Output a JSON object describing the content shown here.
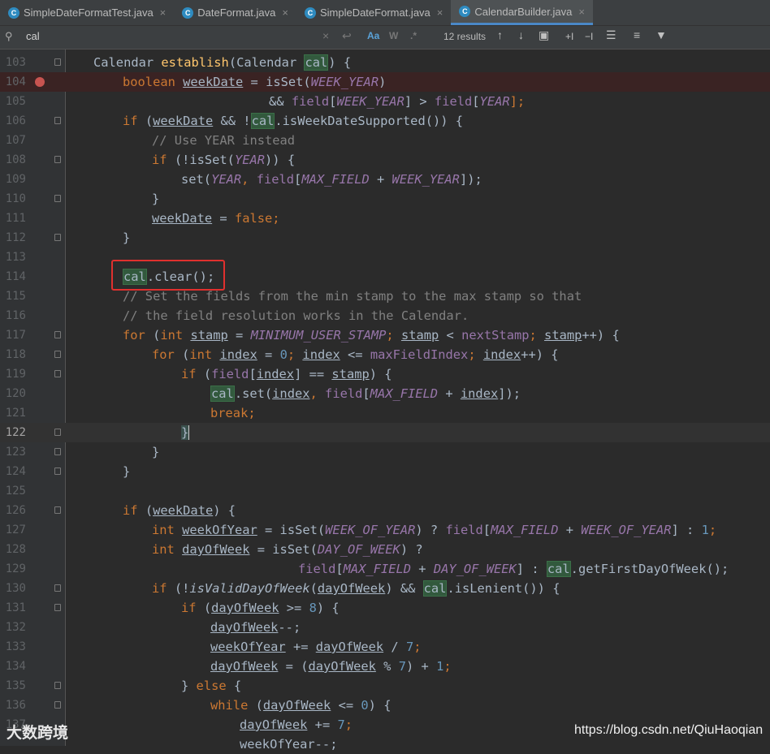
{
  "tabs": [
    {
      "label": "SimpleDateFormatTest.java",
      "active": false,
      "icon": "class-icon"
    },
    {
      "label": "DateFormat.java",
      "active": false,
      "icon": "class-icon"
    },
    {
      "label": "SimpleDateFormat.java",
      "active": false,
      "icon": "class-icon"
    },
    {
      "label": "CalendarBuilder.java",
      "active": true,
      "icon": "class-icon"
    }
  ],
  "tab_icon_letter": "C",
  "tab_close": "×",
  "search": {
    "query": "cal",
    "results": "12 results",
    "opt_match_case": "Aa",
    "opt_words": "W",
    "opt_regex": ".*",
    "search_icon": "⚲",
    "clear_icon": "×",
    "newline_icon": "↩"
  },
  "toolbar": {
    "prev": "↑",
    "next": "↓",
    "select_all": "▣",
    "add_occurrence": "+I",
    "remove_occurrence": "−I",
    "select_all_occurrences": "☰",
    "filter": "▼",
    "multiline": "≡"
  },
  "line_numbers": [
    "103",
    "104",
    "105",
    "106",
    "107",
    "108",
    "109",
    "110",
    "111",
    "112",
    "113",
    "114",
    "115",
    "116",
    "117",
    "118",
    "119",
    "120",
    "121",
    "122",
    "123",
    "124",
    "125",
    "126",
    "127",
    "128",
    "129",
    "130",
    "131",
    "132",
    "133",
    "134",
    "135",
    "136",
    "137"
  ],
  "current_line": "122",
  "breakpoint_line": "104",
  "code": {
    "l103_a": "Calendar ",
    "l103_b": "establish",
    "l103_c": "(Calendar ",
    "l103_d": "cal",
    "l103_e": ") {",
    "l104_a": "boolean ",
    "l104_b": "weekDate",
    " l104_c": " = isSet(",
    "l104_d": "WEEK_YEAR",
    "l104_e": ")",
    "l105_a": "&& ",
    "l105_b": "field",
    "l105_c": "[",
    "l105_d": "WEEK_YEAR",
    "l105_e": "] > ",
    "l105_f": "field",
    "l105_g": "[",
    "l105_h": "YEAR",
    "l105_i": "];",
    "l106_a": "if ",
    "l106_b": "(",
    "l106_c": "weekDate",
    "l106_d": " && !",
    "l106_e": "cal",
    "l106_f": ".isWeekDateSupported()) {",
    "l107": "// Use YEAR instead",
    "l108_a": "if ",
    "l108_b": "(!isSet(",
    "l108_c": "YEAR",
    "l108_d": ")) {",
    "l109_a": "set(",
    "l109_b": "YEAR",
    "l109_c": ", ",
    "l109_d": "field",
    "l109_e": "[",
    "l109_f": "MAX_FIELD",
    "l109_g": " + ",
    "l109_h": "WEEK_YEAR",
    "l109_i": "]);",
    "l110": "}",
    "l111_a": "weekDate",
    "l111_b": " = ",
    "l111_c": "false",
    ";": ";",
    "l112": "}",
    "l114_a": "cal",
    "l114_b": ".clear();",
    "l115": "// Set the fields from the min stamp to the max stamp so that",
    "l116": "// the field resolution works in the Calendar.",
    "l117_a": "for ",
    "l117_b": "(",
    "l117_c": "int ",
    "l117_d": "stamp",
    "l117_e": " = ",
    "l117_f": "MINIMUM_USER_STAMP",
    "l117_g": "; ",
    "l117_h": "stamp",
    "l117_i": " < ",
    "l117_j": "nextStamp",
    "l117_k": "; ",
    "l117_l": "stamp",
    "l117_m": "++) {",
    "l118_a": "for ",
    "l118_b": "(",
    "l118_c": "int ",
    "l118_d": "index",
    "l118_e": " = ",
    "l118_f": "0",
    "l118_g": "; ",
    "l118_h": "index",
    "l118_i": " <= ",
    "l118_j": "maxFieldIndex",
    "l118_k": "; ",
    "l118_l": "index",
    "l118_m": "++) {",
    "l119_a": "if ",
    "l119_b": "(",
    "l119_c": "field",
    "l119_d": "[",
    "l119_e": "index",
    "l119_f": "] == ",
    "l119_g": "stamp",
    "l119_h": ") {",
    "l120_a": "cal",
    "l120_b": ".set(",
    "l120_c": "index",
    "l120_d": ", ",
    "l120_e": "field",
    "l120_f": "[",
    "l120_g": "MAX_FIELD",
    "l120_h": " + ",
    "l120_i": "index",
    "l120_j": "]);",
    "l121": "break;",
    "l122": "}",
    "l123": "}",
    "l124": "}",
    "l126_a": "if ",
    "l126_b": "(",
    "l126_c": "weekDate",
    "l126_d": ") {",
    "l127_a": "int ",
    "l127_b": "weekOfYear",
    "l127_c": " = isSet(",
    "l127_d": "WEEK_OF_YEAR",
    "l127_e": ") ? ",
    "l127_f": "field",
    "l127_g": "[",
    "l127_h": "MAX_FIELD",
    "l127_i": " + ",
    "l127_j": "WEEK_OF_YEAR",
    "l127_k": "] : ",
    "l127_l": "1",
    "l128_a": "int ",
    "l128_b": "dayOfWeek",
    "l128_c": " = isSet(",
    "l128_d": "DAY_OF_WEEK",
    "l128_e": ") ?",
    "l129_a": "field",
    "l129_b": "[",
    "l129_c": "MAX_FIELD",
    "l129_d": " + ",
    "l129_e": "DAY_OF_WEEK",
    "l129_f": "] : ",
    "l129_g": "cal",
    "l129_h": ".getFirstDayOfWeek();",
    "l130_a": "if ",
    "l130_b": "(!",
    "l130_c": "isValidDayOfWeek",
    "l130_d": "(",
    "l130_e": "dayOfWeek",
    "l130_f": ") && ",
    "l130_g": "cal",
    "l130_h": ".isLenient()) {",
    "l131_a": "if ",
    "l131_b": "(",
    "l131_c": "dayOfWeek",
    "l131_d": " >= ",
    "l131_e": "8",
    "l131_f": ") {",
    "l132_a": "dayOfWeek",
    "l132_b": "--;",
    "l133_a": "weekOfYear",
    "l133_b": " += ",
    "l133_c": "dayOfWeek",
    "l133_d": " / ",
    "l133_e": "7",
    "l134_a": "dayOfWeek",
    "l134_b": " = (",
    "l134_c": "dayOfWeek",
    "l134_d": " % ",
    "l134_e": "7",
    "l134_f": ") + ",
    "l134_g": "1",
    "l135_a": "} ",
    "l135_b": "else ",
    "l135_c": "{",
    "l136_a": "while ",
    "l136_b": "(",
    "l136_c": "dayOfWeek",
    "l136_d": " <= ",
    "l136_e": "0",
    "l136_f": ") {",
    "l137_a": "dayOfWeek",
    "l137_b": " += ",
    "l137_c": "7",
    "l138": "weekOfYear--;"
  },
  "watermark_left": "大数跨境",
  "watermark_right": "https://blog.csdn.net/QiuHaoqian"
}
